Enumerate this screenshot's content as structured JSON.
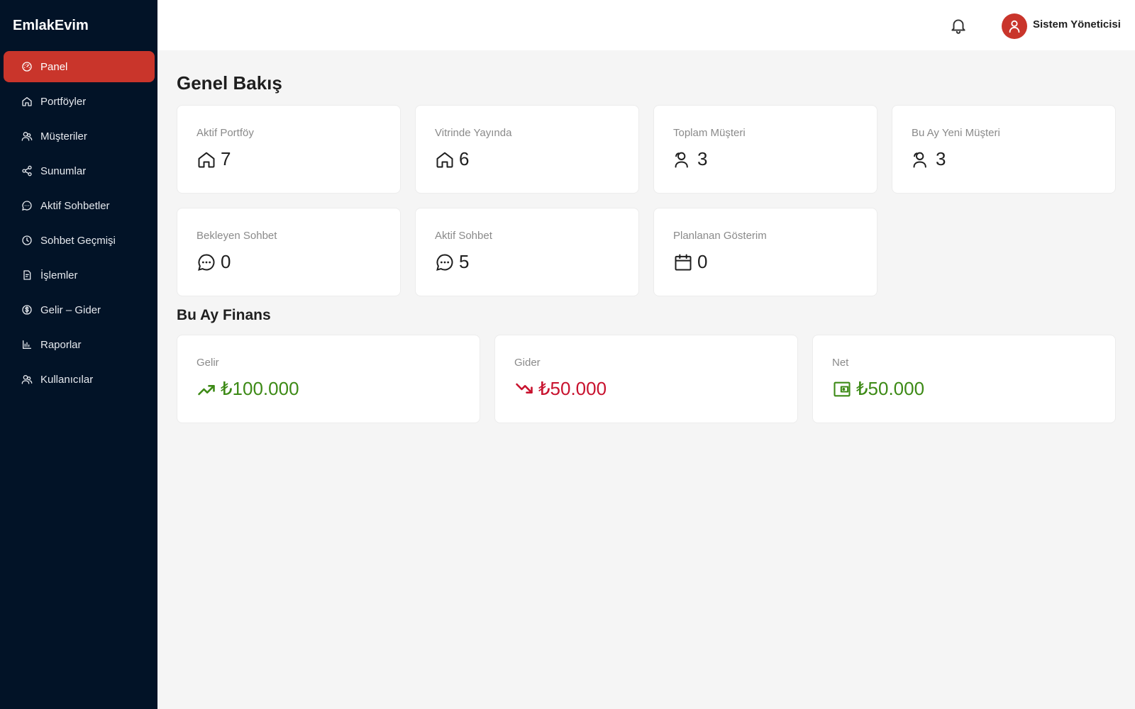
{
  "brand": "EmlakEvim",
  "sidebar": {
    "items": [
      {
        "label": "Panel",
        "icon": "dashboard-icon",
        "active": true
      },
      {
        "label": "Portföyler",
        "icon": "home-icon"
      },
      {
        "label": "Müşteriler",
        "icon": "users-icon"
      },
      {
        "label": "Sunumlar",
        "icon": "share-icon"
      },
      {
        "label": "Aktif Sohbetler",
        "icon": "chat-icon"
      },
      {
        "label": "Sohbet Geçmişi",
        "icon": "history-icon"
      },
      {
        "label": "İşlemler",
        "icon": "document-icon"
      },
      {
        "label": "Gelir – Gider",
        "icon": "dollar-icon"
      },
      {
        "label": "Raporlar",
        "icon": "bar-chart-icon"
      },
      {
        "label": "Kullanıcılar",
        "icon": "user-icon"
      }
    ]
  },
  "header": {
    "user_name": "Sistem Yöneticisi"
  },
  "overview": {
    "title": "Genel Bakış",
    "cards": [
      {
        "label": "Aktif Portföy",
        "value": "7",
        "icon": "home-icon"
      },
      {
        "label": "Vitrinde Yayında",
        "value": "6",
        "icon": "home-icon"
      },
      {
        "label": "Toplam Müşteri",
        "value": "3",
        "icon": "users-icon"
      },
      {
        "label": "Bu Ay Yeni Müşteri",
        "value": "3",
        "icon": "users-icon"
      },
      {
        "label": "Bekleyen Sohbet",
        "value": "0",
        "icon": "chat-icon"
      },
      {
        "label": "Aktif Sohbet",
        "value": "5",
        "icon": "chat-icon"
      },
      {
        "label": "Planlanan Gösterim",
        "value": "0",
        "icon": "calendar-icon"
      }
    ]
  },
  "finance": {
    "title": "Bu Ay Finans",
    "cards": [
      {
        "label": "Gelir",
        "value": "₺100.000",
        "icon": "trend-up-icon"
      },
      {
        "label": "Gider",
        "value": "₺50.000",
        "icon": "trend-down-icon"
      },
      {
        "label": "Net",
        "value": "₺50.000",
        "icon": "wallet-icon"
      }
    ]
  },
  "colors": {
    "sidebar_bg": "#021327",
    "accent": "#c9352b",
    "income": "#3d8a16",
    "expense": "#c8122e"
  }
}
